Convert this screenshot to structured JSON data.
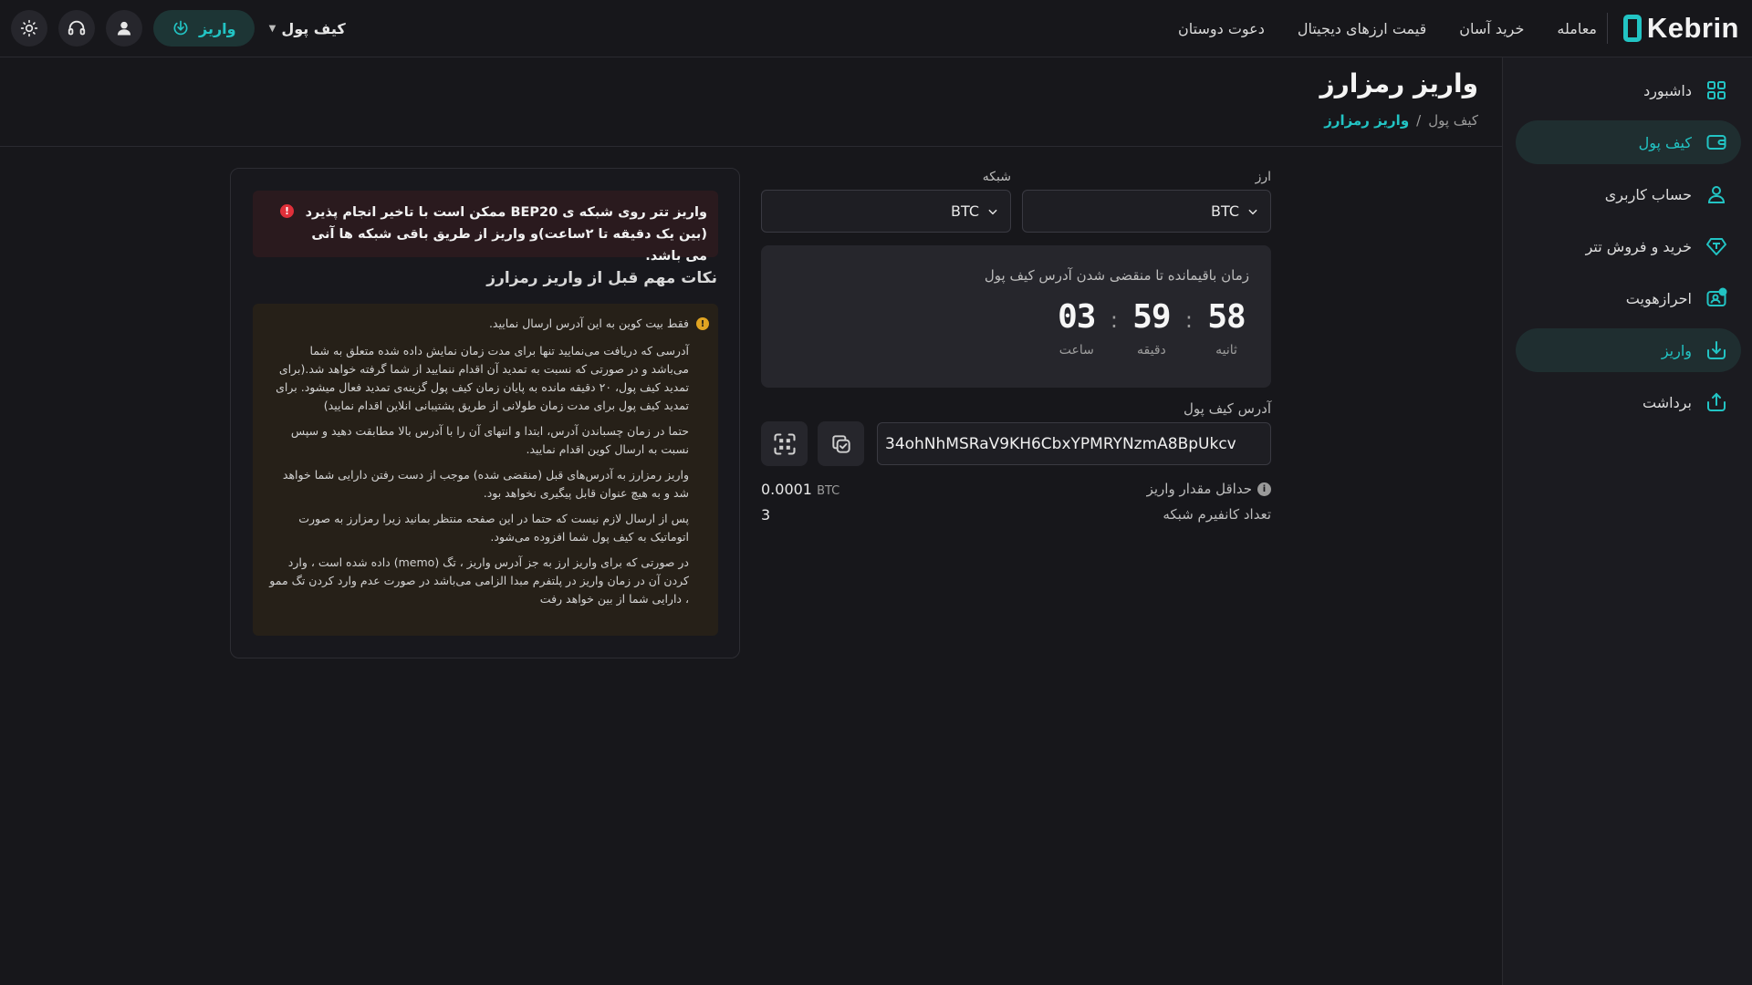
{
  "header": {
    "brand": "Kebrin",
    "nav": [
      "معامله",
      "خرید آسان",
      "قیمت ارزهای دیجیتال",
      "دعوت دوستان"
    ],
    "wallet_dropdown": "کیف پول",
    "deposit_button": "واریز"
  },
  "sidebar": {
    "items": [
      {
        "label": "داشبورد",
        "icon": "dashboard-icon"
      },
      {
        "label": "کیف پول",
        "icon": "wallet-icon"
      },
      {
        "label": "حساب کاربری",
        "icon": "user-icon"
      },
      {
        "label": "خرید و فروش تتر",
        "icon": "tether-icon"
      },
      {
        "label": "احرازهویت",
        "icon": "id-verify-icon"
      },
      {
        "label": "واریز",
        "icon": "deposit-icon"
      },
      {
        "label": "برداشت",
        "icon": "withdraw-icon"
      }
    ],
    "active": [
      "کیف پول",
      "واریز"
    ]
  },
  "page": {
    "title": "واریز رمزارز",
    "breadcrumb": {
      "parent": "کیف پول",
      "separator": "/",
      "current": "واریز رمزارز"
    }
  },
  "form": {
    "currency_label": "ارز",
    "currency_value": "BTC",
    "network_label": "شبکه",
    "network_value": "BTC",
    "timer_caption": "زمان باقیمانده تا منقضی شدن آدرس کیف پول",
    "timer": {
      "seconds": "58",
      "seconds_label": "ثانیه",
      "minutes": "59",
      "minutes_label": "دقیقه",
      "hours": "03",
      "hours_label": "ساعت",
      "separator": ":"
    },
    "address_label": "آدرس کیف پول",
    "address_value": "34ohNhMSRaV9KH6CbxYPMRYNzmA8BpUkcv",
    "min_deposit_label": "حداقل مقدار واریز",
    "min_deposit_value": "0.0001",
    "min_deposit_unit": "BTC",
    "confirmations_label": "تعداد کانفیرم شبکه",
    "confirmations_value": "3"
  },
  "notes": {
    "alert": "واریز تتر روی شبکه ی BEP20 ممکن است با تاخیر انجام پذیرد (بین یک دقیقه تا ۲ساعت)و واریز از طریق باقی شبکه ها آنی می باشد.",
    "title": "نکات مهم قبل از واریز رمزارز",
    "tips": [
      "فقط بیت کوین به این آدرس ارسال نمایید.",
      "آدرسی که دریافت می‌نمایید تنها برای مدت زمان نمایش داده شده متعلق به شما می‌باشد و در صورتی که نسبت به تمدید آن اقدام ننمایید از شما گرفته خواهد شد.(برای تمدید کیف پول، ۲۰ دقیقه مانده به پایان زمان کیف پول گزینه‌ی تمدید فعال میشود. برای تمدید کیف پول برای مدت زمان طولانی از طریق پشتیبانی انلاین اقدام نمایید)",
      "حتما در زمان چسباندن آدرس، ابتدا و انتهای آن را با آدرس بالا مطابقت دهید و سپس نسبت به ارسال کوین اقدام نمایید.",
      "واریز رمزارز به آدرس‌های قبل (منقضی شده) موجب از دست رفتن دارایی شما خواهد شد و به هیچ عنوان قابل پیگیری نخواهد بود.",
      "پس از ارسال لازم نیست که حتما در این صفحه منتظر بمانید زیرا رمزارز به صورت اتوماتیک به کیف پول شما افزوده می‌شود.",
      "در صورتی که برای واریز ارز به جز آدرس واریز ، تگ (memo) داده شده است ، وارد کردن آن در زمان واریز در پلتفرم مبدا الزامی می‌باشد در صورت عدم وارد کردن تگ ممو ، دارایی شما از بین خواهد رفت"
    ]
  },
  "colors": {
    "accent": "#22c4c4",
    "background": "#17171b",
    "alert": "#e0303a",
    "warning": "#e0a422"
  }
}
